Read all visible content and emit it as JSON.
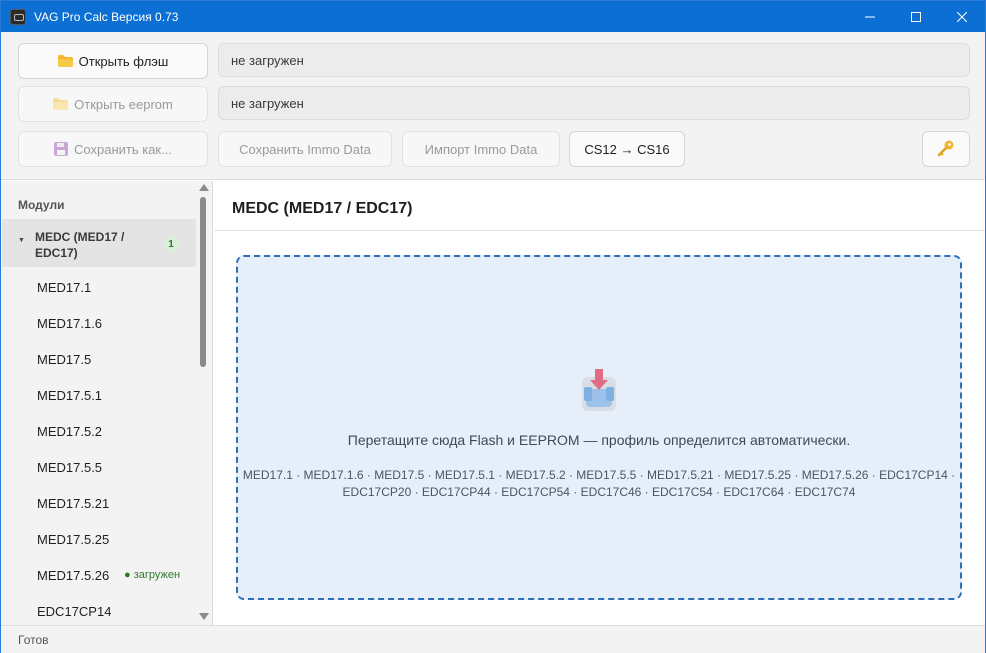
{
  "window": {
    "title": "VAG Pro Calc Версия 0.73",
    "controls": {
      "minimize": "minimize-icon",
      "maximize": "maximize-icon",
      "close": "close-icon"
    }
  },
  "toolbar": {
    "open_flash_label": "Открыть флэш",
    "open_eeprom_label": "Открыть eeprom",
    "flash_status": "не загружен",
    "eeprom_status": "не загружен",
    "save_as_label": "Сохранить как...",
    "save_immo_label": "Сохранить Immo Data",
    "import_immo_label": "Импорт Immo Data",
    "cs_convert_label": "CS12 → CS16",
    "key_button_icon": "key-icon"
  },
  "sidebar": {
    "header": "Модули",
    "group": {
      "label": "MEDC (MED17 / EDC17)",
      "count": "1"
    },
    "items": [
      {
        "label": "MED17.1",
        "status": ""
      },
      {
        "label": "MED17.1.6",
        "status": ""
      },
      {
        "label": "MED17.5",
        "status": ""
      },
      {
        "label": "MED17.5.1",
        "status": ""
      },
      {
        "label": "MED17.5.2",
        "status": ""
      },
      {
        "label": "MED17.5.5",
        "status": ""
      },
      {
        "label": "MED17.5.21",
        "status": ""
      },
      {
        "label": "MED17.5.25",
        "status": ""
      },
      {
        "label": "MED17.5.26",
        "status": "● загружен"
      },
      {
        "label": "EDC17CP14",
        "status": ""
      }
    ]
  },
  "main": {
    "title": "MEDC (MED17 / EDC17)",
    "dropzone": {
      "icon": "download-tray-icon",
      "text": "Перетащите сюда Flash и EEPROM — профиль определится автоматически.",
      "supported_line1": "MED17.1 · MED17.1.6 · MED17.5 · MED17.5.1 · MED17.5.2 · MED17.5.5 · MED17.5.21 · MED17.5.25 · MED17.5.26 · EDC17CP14 ·",
      "supported_line2": "EDC17CP20 · EDC17CP44 · EDC17CP54 · EDC17C46 · EDC17C54 · EDC17C64 · EDC17C74"
    }
  },
  "statusbar": {
    "text": "Готов"
  },
  "colors": {
    "titlebar": "#0b6fd3",
    "accent": "#2f6fb7",
    "dropzone_bg": "#e6eef9",
    "loaded_green": "#2c7a2c"
  }
}
